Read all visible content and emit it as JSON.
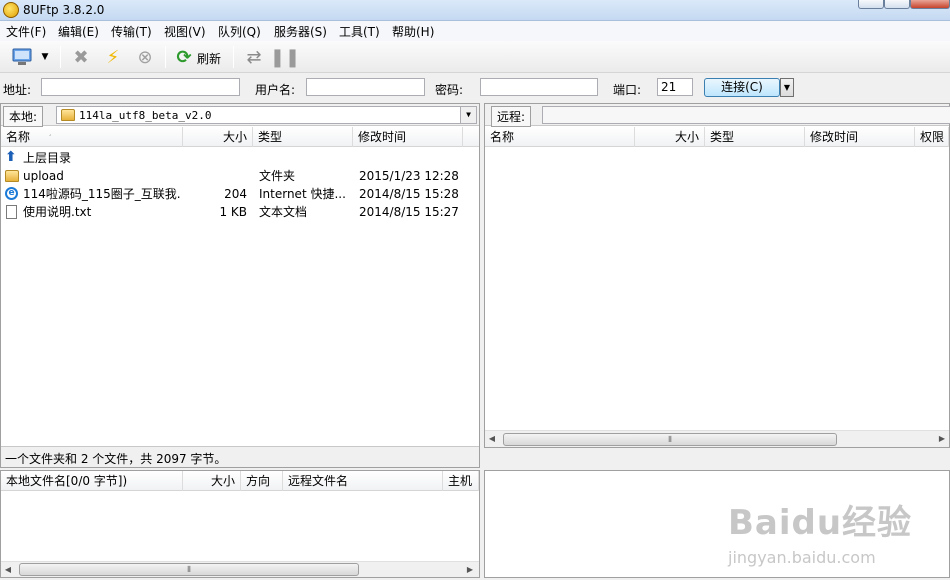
{
  "window": {
    "title": "8UFtp 3.8.2.0"
  },
  "menu": [
    "文件(F)",
    "编辑(E)",
    "传输(T)",
    "视图(V)",
    "队列(Q)",
    "服务器(S)",
    "工具(T)",
    "帮助(H)"
  ],
  "toolbar": {
    "refresh_label": "刷新"
  },
  "connection": {
    "address_label": "地址:",
    "username_label": "用户名:",
    "password_label": "密码:",
    "port_label": "端口:",
    "port_value": "21",
    "connect_label": "连接(C)"
  },
  "local": {
    "label": "本地:",
    "path": "114la_utf8_beta_v2.0",
    "columns": [
      "名称",
      "大小",
      "类型",
      "修改时间"
    ],
    "parent_dir": "上层目录",
    "files": [
      {
        "name": "upload",
        "size": "",
        "type": "文件夹",
        "modified": "2015/1/23 12:28",
        "icon": "folder-icon"
      },
      {
        "name": "114啦源码_115圈子_互联我...",
        "size": "204",
        "type": "Internet 快捷...",
        "modified": "2014/8/15 15:28",
        "icon": "internet-shortcut-icon"
      },
      {
        "name": "使用说明.txt",
        "size": "1 KB",
        "type": "文本文档",
        "modified": "2014/8/15 15:27",
        "icon": "text-file-icon"
      }
    ],
    "status": "一个文件夹和 2 个文件，共 2097 字节。"
  },
  "remote": {
    "label": "远程:",
    "columns": [
      "名称",
      "大小",
      "类型",
      "修改时间",
      "权限"
    ]
  },
  "queue": {
    "columns": [
      "本地文件名[0/0 字节])",
      "大小",
      "方向",
      "远程文件名",
      "主机"
    ]
  },
  "watermark": {
    "logo": "Baidu经验",
    "sub": "jingyan.baidu.com"
  }
}
